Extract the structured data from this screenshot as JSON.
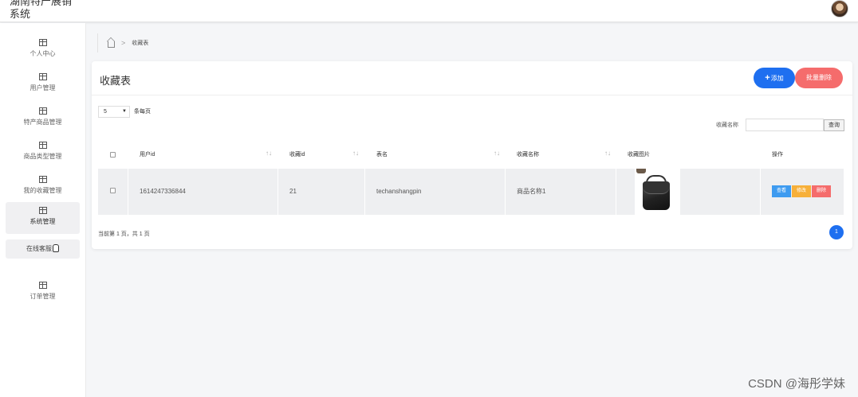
{
  "header": {
    "app_title": "湖南特产展销\n系统"
  },
  "sidebar": {
    "items": [
      {
        "label": "个人中心"
      },
      {
        "label": "用户管理"
      },
      {
        "label": "特产商品管理"
      },
      {
        "label": "商品类型管理"
      },
      {
        "label": "我的收藏管理"
      },
      {
        "label": "系统管理"
      },
      {
        "label": "订单管理"
      }
    ],
    "sub_item": "在线客服"
  },
  "breadcrumb": {
    "current": "收藏表"
  },
  "card": {
    "title": "收藏表",
    "add_label": "添加",
    "batch_delete_label": "批量删除",
    "page_size_value": "5",
    "per_page_label": "条每页",
    "search_label": "收藏名称",
    "search_value": "",
    "search_button": "查询"
  },
  "table": {
    "columns": [
      "用户id",
      "收藏id",
      "表名",
      "收藏名称",
      "收藏图片",
      "操作"
    ],
    "rows": [
      {
        "user_id": "1614247336844",
        "fav_id": "21",
        "table_name": "techanshangpin",
        "fav_name": "商品名称1",
        "actions": [
          "查看",
          "修改",
          "删除"
        ]
      }
    ]
  },
  "pagination": {
    "summary": "当前第 1 页，共 1 页",
    "current_page": "1"
  },
  "watermark": "CSDN @海彤学妹",
  "colors": {
    "primary": "#1e6ff0",
    "danger": "#f56c6c",
    "view": "#3e9bf0",
    "edit": "#f7b03a",
    "delete": "#f56c6c"
  }
}
